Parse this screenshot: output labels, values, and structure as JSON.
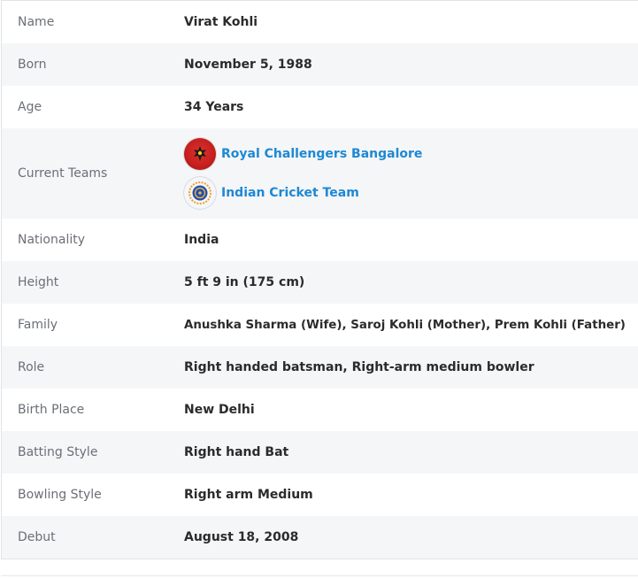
{
  "profile": {
    "rows": [
      {
        "label": "Name",
        "value": "Virat Kohli"
      },
      {
        "label": "Born",
        "value": "November 5, 1988"
      },
      {
        "label": "Age",
        "value": "34 Years"
      },
      {
        "label": "Current Teams"
      },
      {
        "label": "Nationality",
        "value": "India"
      },
      {
        "label": "Height",
        "value": "5 ft 9 in (175 cm)"
      },
      {
        "label": "Family",
        "value": "Anushka Sharma (Wife), Saroj Kohli (Mother), Prem Kohli (Father)"
      },
      {
        "label": "Role",
        "value": "Right handed batsman, Right-arm medium bowler"
      },
      {
        "label": "Birth Place",
        "value": "New Delhi"
      },
      {
        "label": "Batting Style",
        "value": "Right hand Bat"
      },
      {
        "label": "Bowling Style",
        "value": "Right arm Medium"
      },
      {
        "label": "Debut",
        "value": "August 18, 2008"
      }
    ],
    "teams": [
      {
        "name": "Royal Challengers Bangalore",
        "icon": "rcb-logo-icon",
        "color": "#1e88d4"
      },
      {
        "name": "Indian Cricket Team",
        "icon": "bcci-logo-icon",
        "color": "#1e88d4"
      }
    ]
  },
  "colors": {
    "label": "#6b6f76",
    "value": "#2b2b2b",
    "link": "#1e88d4",
    "row_alt": "#f5f6f8"
  }
}
